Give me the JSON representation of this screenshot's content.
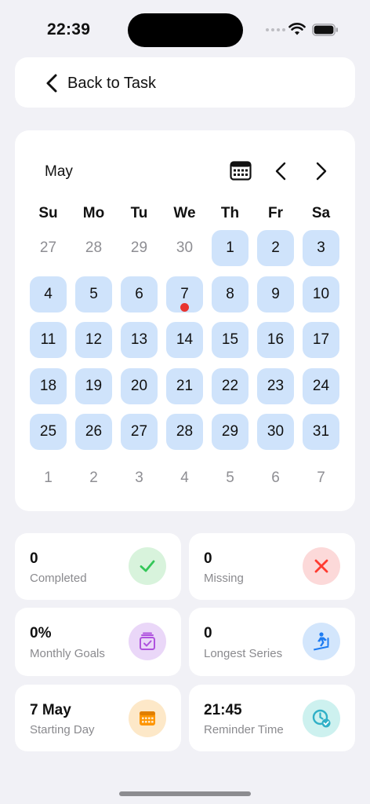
{
  "status": {
    "time": "22:39"
  },
  "header": {
    "back_label": "Back to Task"
  },
  "calendar": {
    "month": "May",
    "weekdays": [
      "Su",
      "Mo",
      "Tu",
      "We",
      "Th",
      "Fr",
      "Sa"
    ],
    "highlight_color": "#cfe3fb",
    "marker_color": "#e8342f",
    "marked_day": "7",
    "weeks": [
      [
        {
          "d": "27",
          "s": "muted"
        },
        {
          "d": "28",
          "s": "muted"
        },
        {
          "d": "29",
          "s": "muted"
        },
        {
          "d": "30",
          "s": "muted"
        },
        {
          "d": "1",
          "s": "active"
        },
        {
          "d": "2",
          "s": "active"
        },
        {
          "d": "3",
          "s": "active"
        }
      ],
      [
        {
          "d": "4",
          "s": "active"
        },
        {
          "d": "5",
          "s": "active"
        },
        {
          "d": "6",
          "s": "active"
        },
        {
          "d": "7",
          "s": "active"
        },
        {
          "d": "8",
          "s": "active"
        },
        {
          "d": "9",
          "s": "active"
        },
        {
          "d": "10",
          "s": "active"
        }
      ],
      [
        {
          "d": "11",
          "s": "active"
        },
        {
          "d": "12",
          "s": "active"
        },
        {
          "d": "13",
          "s": "active"
        },
        {
          "d": "14",
          "s": "active"
        },
        {
          "d": "15",
          "s": "active"
        },
        {
          "d": "16",
          "s": "active"
        },
        {
          "d": "17",
          "s": "active"
        }
      ],
      [
        {
          "d": "18",
          "s": "active"
        },
        {
          "d": "19",
          "s": "active"
        },
        {
          "d": "20",
          "s": "active"
        },
        {
          "d": "21",
          "s": "active"
        },
        {
          "d": "22",
          "s": "active"
        },
        {
          "d": "23",
          "s": "active"
        },
        {
          "d": "24",
          "s": "active"
        }
      ],
      [
        {
          "d": "25",
          "s": "active"
        },
        {
          "d": "26",
          "s": "active"
        },
        {
          "d": "27",
          "s": "active"
        },
        {
          "d": "28",
          "s": "active"
        },
        {
          "d": "29",
          "s": "active"
        },
        {
          "d": "30",
          "s": "active"
        },
        {
          "d": "31",
          "s": "active"
        }
      ],
      [
        {
          "d": "1",
          "s": "muted"
        },
        {
          "d": "2",
          "s": "muted"
        },
        {
          "d": "3",
          "s": "muted"
        },
        {
          "d": "4",
          "s": "muted"
        },
        {
          "d": "5",
          "s": "muted"
        },
        {
          "d": "6",
          "s": "muted"
        },
        {
          "d": "7",
          "s": "muted"
        }
      ]
    ]
  },
  "stats": {
    "completed": {
      "value": "0",
      "label": "Completed",
      "icon": "checkmark-icon",
      "bg": "#d8f3dc",
      "fg": "#34c759"
    },
    "missing": {
      "value": "0",
      "label": "Missing",
      "icon": "x-icon",
      "bg": "#fcd9d9",
      "fg": "#ff3b30"
    },
    "monthly_goals": {
      "value": "0%",
      "label": "Monthly Goals",
      "icon": "goals-icon",
      "bg": "#ead7f8",
      "fg": "#af52de"
    },
    "longest_series": {
      "value": "0",
      "label": "Longest Series",
      "icon": "treadmill-icon",
      "bg": "#d3e6fc",
      "fg": "#1e7cf2"
    },
    "starting_day": {
      "value": "7 May",
      "label": "Starting Day",
      "icon": "calendar-icon",
      "bg": "#fde8c8",
      "fg": "#ff9500"
    },
    "reminder_time": {
      "value": "21:45",
      "label": "Reminder Time",
      "icon": "clock-check-icon",
      "bg": "#cdf1ef",
      "fg": "#30b0c7"
    }
  }
}
